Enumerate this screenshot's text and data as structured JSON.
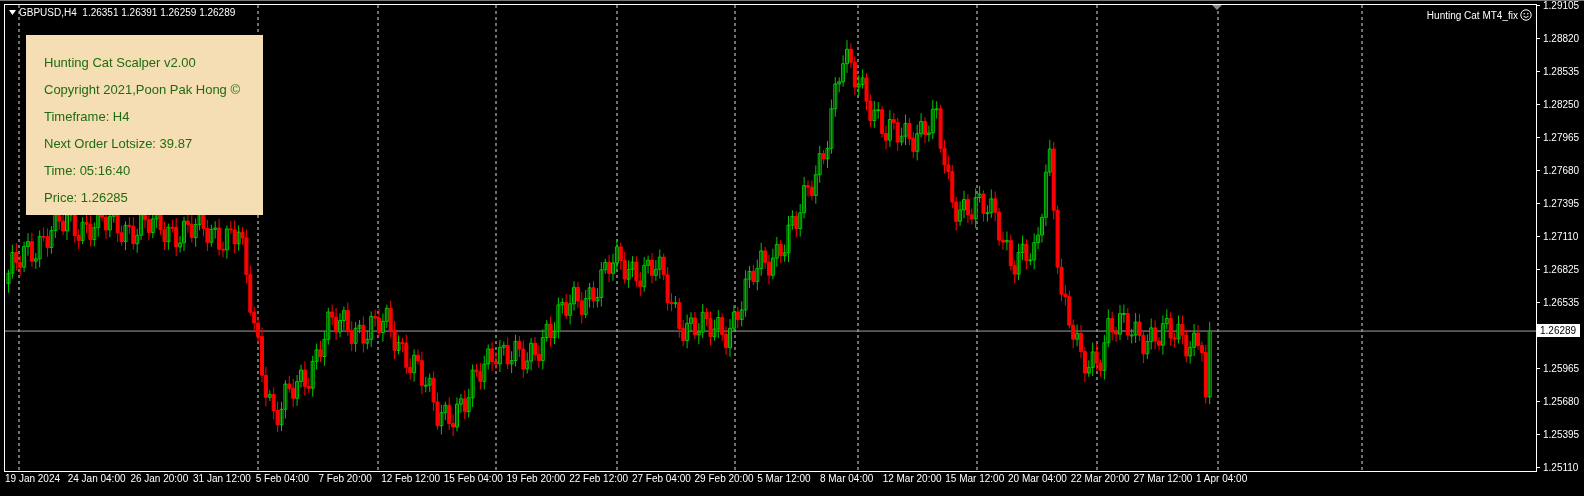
{
  "chart": {
    "header": "GBPUSD,H4  1.26351 1.26391 1.26259 1.26289",
    "indicator_label": "Hunting Cat MT4_fix",
    "info_panel": {
      "lines": [
        "Hunting Cat Scalper v2.00",
        "Copyright 2021,Poon Pak Hong ©",
        "Timeframe: H4",
        "Next Order Lotsize: 39.87",
        "Time: 05:16:40",
        "Price: 1.26285"
      ]
    },
    "price_axis": {
      "ticks": [
        "1.29105",
        "1.28820",
        "1.28535",
        "1.28250",
        "1.27965",
        "1.27680",
        "1.27395",
        "1.27110",
        "1.26825",
        "1.26535",
        "1.25965",
        "1.25680",
        "1.25395",
        "1.25110"
      ],
      "current_price": "1.26289"
    },
    "time_axis": {
      "labels": [
        "19 Jan 2024",
        "24 Jan 04:00",
        "26 Jan 20:00",
        "31 Jan 12:00",
        "5 Feb 04:00",
        "7 Feb 20:00",
        "12 Feb 12:00",
        "15 Feb 04:00",
        "19 Feb 20:00",
        "22 Feb 12:00",
        "27 Feb 04:00",
        "29 Feb 20:00",
        "5 Mar 12:00",
        "8 Mar 04:00",
        "12 Mar 20:00",
        "15 Mar 12:00",
        "20 Mar 04:00",
        "22 Mar 20:00",
        "27 Mar 12:00",
        "1 Apr 04:00"
      ]
    }
  }
}
